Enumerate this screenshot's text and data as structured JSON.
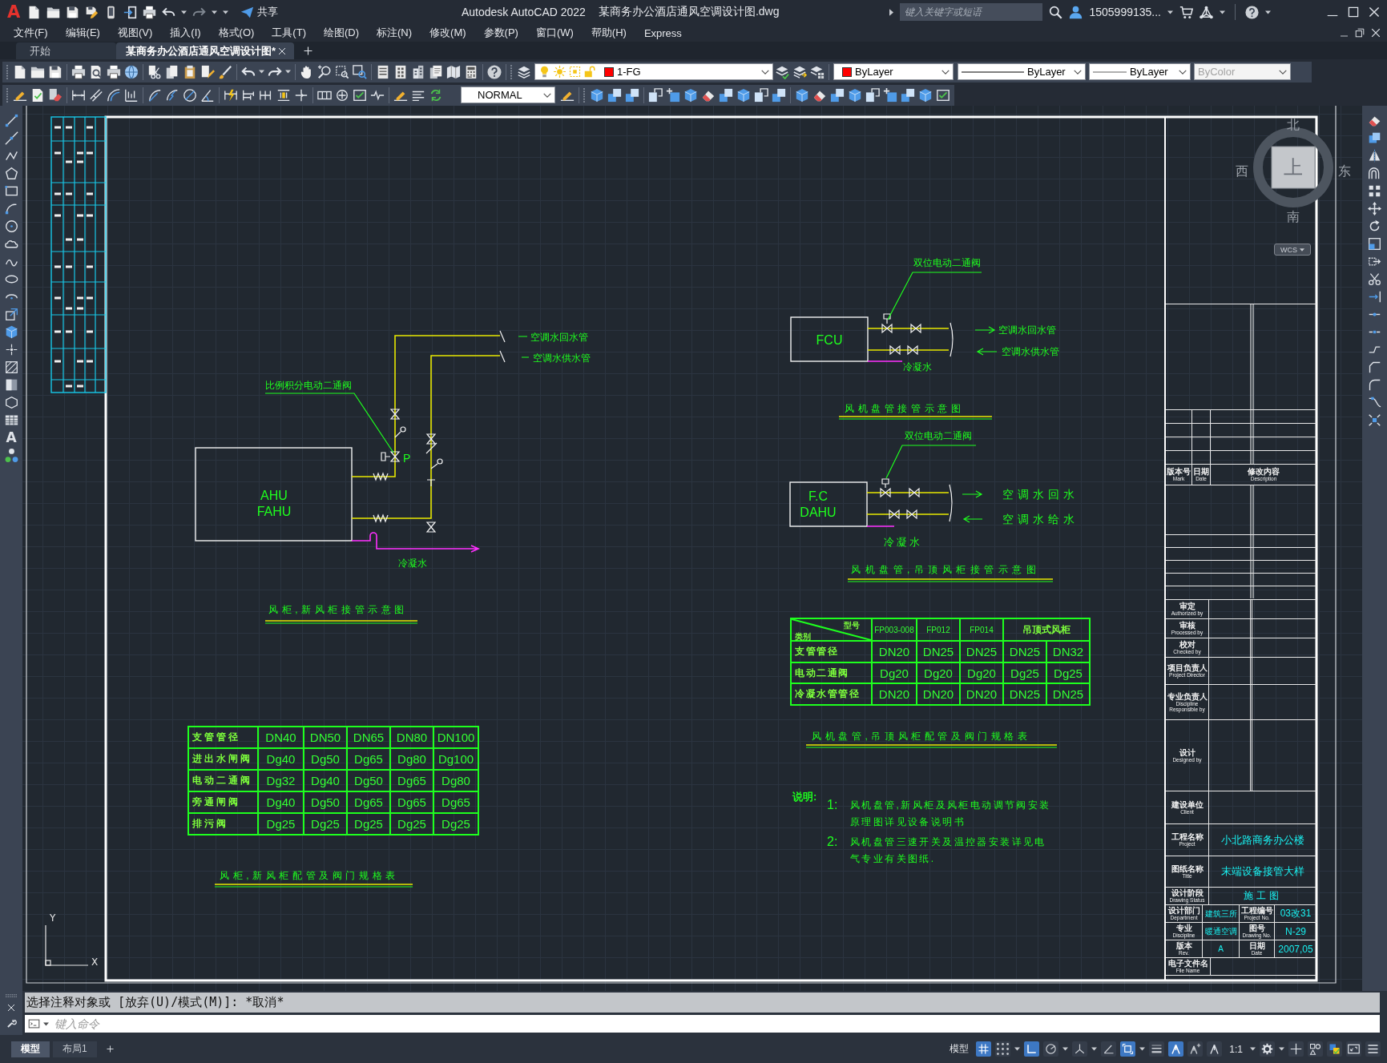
{
  "title_bar": {
    "logo": "A",
    "share": "共享",
    "app_name": "Autodesk AutoCAD 2022",
    "file_name": "某商务办公酒店通风空调设计图.dwg",
    "search": {
      "placeholder": "键入关键字或短语"
    },
    "user": "1505999135..."
  },
  "menu_bar": [
    "文件(F)",
    "编辑(E)",
    "视图(V)",
    "插入(I)",
    "格式(O)",
    "工具(T)",
    "绘图(D)",
    "标注(N)",
    "修改(M)",
    "参数(P)",
    "窗口(W)",
    "帮助(H)",
    "Express"
  ],
  "file_tabs": [
    {
      "label": "开始",
      "selected": false
    },
    {
      "label": "某商务办公酒店通风空调设计图*",
      "selected": true
    }
  ],
  "properties_toolbar": {
    "layer": {
      "value": "1-FG",
      "color": "#ff0000"
    },
    "color_control": {
      "value": "ByLayer",
      "color": "#ff0000"
    },
    "linetype": "ByLayer",
    "lineweight": "ByLayer",
    "plot_style": {
      "value": "ByColor",
      "disabled": true
    }
  },
  "dimension_style": "NORMAL",
  "draw_toolbar": {
    "text_tool": "A"
  },
  "drawing": {
    "ahu_diagram": {
      "valve_label": "比例积分电动二通阀",
      "return_label": "空调水回水管",
      "supply_label": "空调水供水管",
      "valve_mark": "P",
      "unit_labels": [
        "AHU",
        "FAHU"
      ],
      "condensate_label": "冷凝水",
      "title": "风柜,新风柜接管示意图"
    },
    "fcu_diagram": {
      "valve_label": "双位电动二通阀",
      "unit_labels": [
        "FCU"
      ],
      "return_label": "空调水回水管",
      "supply_label": "空调水供水管",
      "condensate_label": "冷凝水",
      "title": "风机盘管接管示意图"
    },
    "dahu_diagram": {
      "valve_label": "双位电动二通阀",
      "unit_labels": [
        "F.C",
        "DAHU"
      ],
      "return_label": "空调水回水",
      "supply_label": "空调水给水",
      "condensate_label": "冷凝水",
      "title": "风机盘管,吊顶风柜接管示意图"
    },
    "fcu_table": {
      "corner": {
        "column_header": "型号",
        "row_header": "类别"
      },
      "columns": [
        "FP003-008",
        "FP012",
        "FP014",
        "吊顶式风柜"
      ],
      "rows": [
        {
          "label": "支管管径",
          "values": [
            "DN20",
            "DN25",
            "DN25",
            "DN25",
            "DN32"
          ]
        },
        {
          "label": "电动二通阀",
          "values": [
            "Dg20",
            "Dg20",
            "Dg20",
            "Dg25",
            "Dg25"
          ]
        },
        {
          "label": "冷凝水管管径",
          "values": [
            "DN20",
            "DN20",
            "DN20",
            "DN25",
            "DN25"
          ]
        }
      ],
      "title": "风机盘管,吊顶风柜配管及阀门规格表"
    },
    "notes": {
      "heading": "说明:",
      "items": [
        {
          "number": "1:",
          "lines": [
            "风机盘管,新风柜及风柜电动调节阀安装",
            "原理图详见设备说明书"
          ]
        },
        {
          "number": "2:",
          "lines": [
            "风机盘管三速开关及温控器安装详见电",
            "气专业有关图纸."
          ]
        }
      ]
    },
    "ahu_table": {
      "rows": [
        {
          "label": "支管管径",
          "values": [
            "DN40",
            "DN50",
            "DN65",
            "DN80",
            "DN100"
          ]
        },
        {
          "label": "进出水闸阀",
          "values": [
            "Dg40",
            "Dg50",
            "Dg65",
            "Dg80",
            "Dg100"
          ]
        },
        {
          "label": "电动二通阀",
          "values": [
            "Dg32",
            "Dg40",
            "Dg50",
            "Dg65",
            "Dg80"
          ]
        },
        {
          "label": "旁通闸阀",
          "values": [
            "Dg40",
            "Dg50",
            "Dg65",
            "Dg65",
            "Dg65"
          ]
        },
        {
          "label": "排污阀",
          "values": [
            "Dg25",
            "Dg25",
            "Dg25",
            "Dg25",
            "Dg25"
          ]
        }
      ],
      "title": "风柜,新风柜配管及阀门规格表"
    },
    "ucs_icon": {
      "x_label": "X",
      "y_label": "Y"
    },
    "title_block": {
      "revision_columns": [
        {
          "label": "版本号",
          "label_en": "Mark"
        },
        {
          "label": "日期",
          "label_en": "Date"
        },
        {
          "label": "修改内容",
          "label_en": "Description"
        }
      ],
      "signatures": [
        {
          "label": "审定",
          "label_en": "Authorized by"
        },
        {
          "label": "审核",
          "label_en": "Processed by"
        },
        {
          "label": "校对",
          "label_en": "Checked by"
        },
        {
          "label": "项目负责人",
          "label_en": "Project Director"
        },
        {
          "label": "专业负责人",
          "label_en": "Discipline Responsible by"
        },
        {
          "label": "设计",
          "label_en": "Designed by"
        }
      ],
      "fields": [
        {
          "label": "建设单位",
          "label_en": "Client"
        },
        {
          "label": "工程名称",
          "label_en": "Project",
          "value": "小北路商务办公楼"
        },
        {
          "label": "图纸名称",
          "label_en": "Title",
          "value": "末端设备接管大样"
        },
        {
          "label": "设计阶段",
          "label_en": "Drawing Status",
          "value": "施工图"
        }
      ],
      "grid": [
        [
          {
            "label": "设计部门",
            "label_en": "Department",
            "value": "建筑三所"
          },
          {
            "label": "工程编号",
            "label_en": "Project No.",
            "value": "03改31"
          }
        ],
        [
          {
            "label": "专业",
            "label_en": "Discipline",
            "value": "暖通空调"
          },
          {
            "label": "图号",
            "label_en": "Drawing No.",
            "value": "N-29"
          }
        ],
        [
          {
            "label": "版本",
            "label_en": "Rev.",
            "value": "A"
          },
          {
            "label": "日期",
            "label_en": "Date",
            "value": "2007,05"
          }
        ]
      ],
      "file": {
        "label": "电子文件名",
        "label_en": "File Name"
      }
    }
  },
  "viewcube": {
    "north": "北",
    "west": "西",
    "east": "东",
    "south": "南",
    "top": "上",
    "wcs": "WCS"
  },
  "command_line": {
    "history": "选择注释对象或 [放弃(U)/模式(M)]: *取消*",
    "input": {
      "placeholder": "键入命令"
    }
  },
  "layout_tabs": [
    {
      "label": "模型",
      "selected": true
    },
    {
      "label": "布局1",
      "selected": false
    }
  ],
  "status_bar": {
    "space": "模型",
    "toggles": [
      {
        "on": true
      },
      {
        "on": false
      },
      {
        "on": true
      },
      {
        "on": false
      },
      {
        "on": false
      },
      {
        "on": false
      },
      {
        "on": true
      },
      {
        "on": false
      },
      {
        "on": true
      },
      {
        "on": false
      }
    ],
    "annotation_scale": "1:1"
  }
}
